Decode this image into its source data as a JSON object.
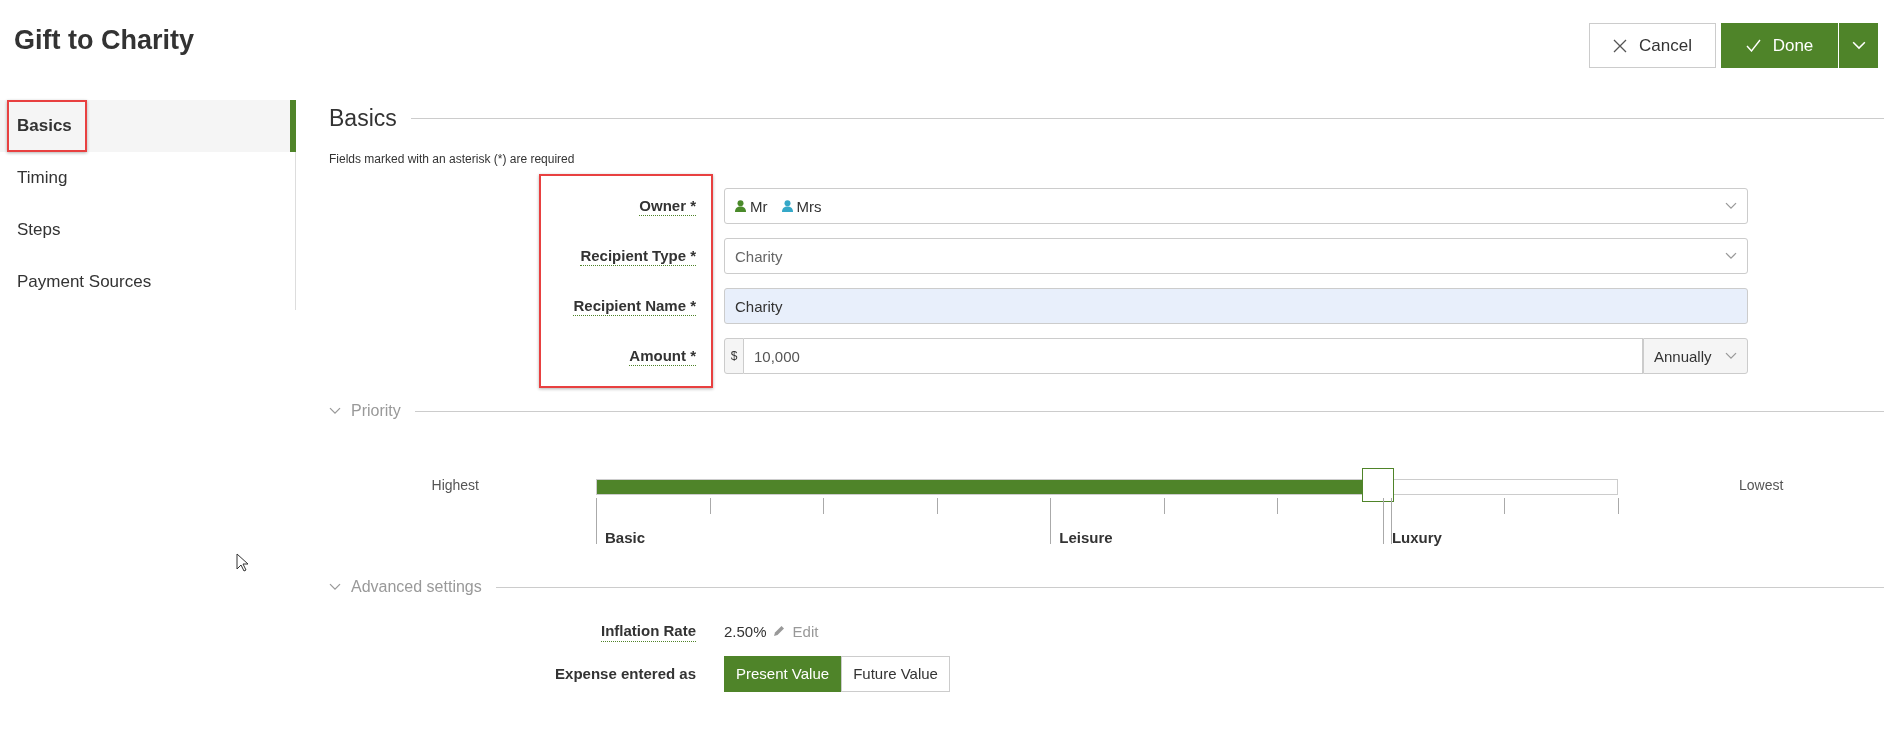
{
  "title": "Gift to Charity",
  "actions": {
    "cancel": "Cancel",
    "done": "Done"
  },
  "sidebar": {
    "items": [
      {
        "label": "Basics",
        "selected": true,
        "highlighted": true
      },
      {
        "label": "Timing",
        "selected": false,
        "highlighted": false
      },
      {
        "label": "Steps",
        "selected": false,
        "highlighted": false
      },
      {
        "label": "Payment Sources",
        "selected": false,
        "highlighted": false
      }
    ]
  },
  "basics": {
    "heading": "Basics",
    "note": "Fields marked with an asterisk (*) are required",
    "labels_highlighted": true,
    "fields": [
      {
        "kind": "owners",
        "label": "Owner *",
        "owners": [
          {
            "name": "Mr",
            "color": "#4a8a2a"
          },
          {
            "name": "Mrs",
            "color": "#35a8c8"
          }
        ]
      },
      {
        "kind": "select",
        "label": "Recipient Type *",
        "value": "Charity"
      },
      {
        "kind": "text",
        "label": "Recipient Name *",
        "value": "Charity"
      },
      {
        "kind": "amount",
        "label": "Amount *",
        "prefix": "$",
        "value": "10,000",
        "period": "Annually"
      }
    ]
  },
  "priority": {
    "heading": "Priority",
    "expanded": true,
    "low_label": "Highest",
    "high_label": "Lowest",
    "level": 0.765,
    "categories": [
      "Basic",
      "Leisure",
      "Luxury"
    ]
  },
  "advanced": {
    "heading": "Advanced settings",
    "expanded": true,
    "inflation_label": "Inflation Rate",
    "inflation_value": "2.50%",
    "edit": "Edit",
    "expense_label": "Expense entered as",
    "expense_options": [
      {
        "label": "Present Value",
        "selected": true
      },
      {
        "label": "Future Value",
        "selected": false
      }
    ]
  }
}
